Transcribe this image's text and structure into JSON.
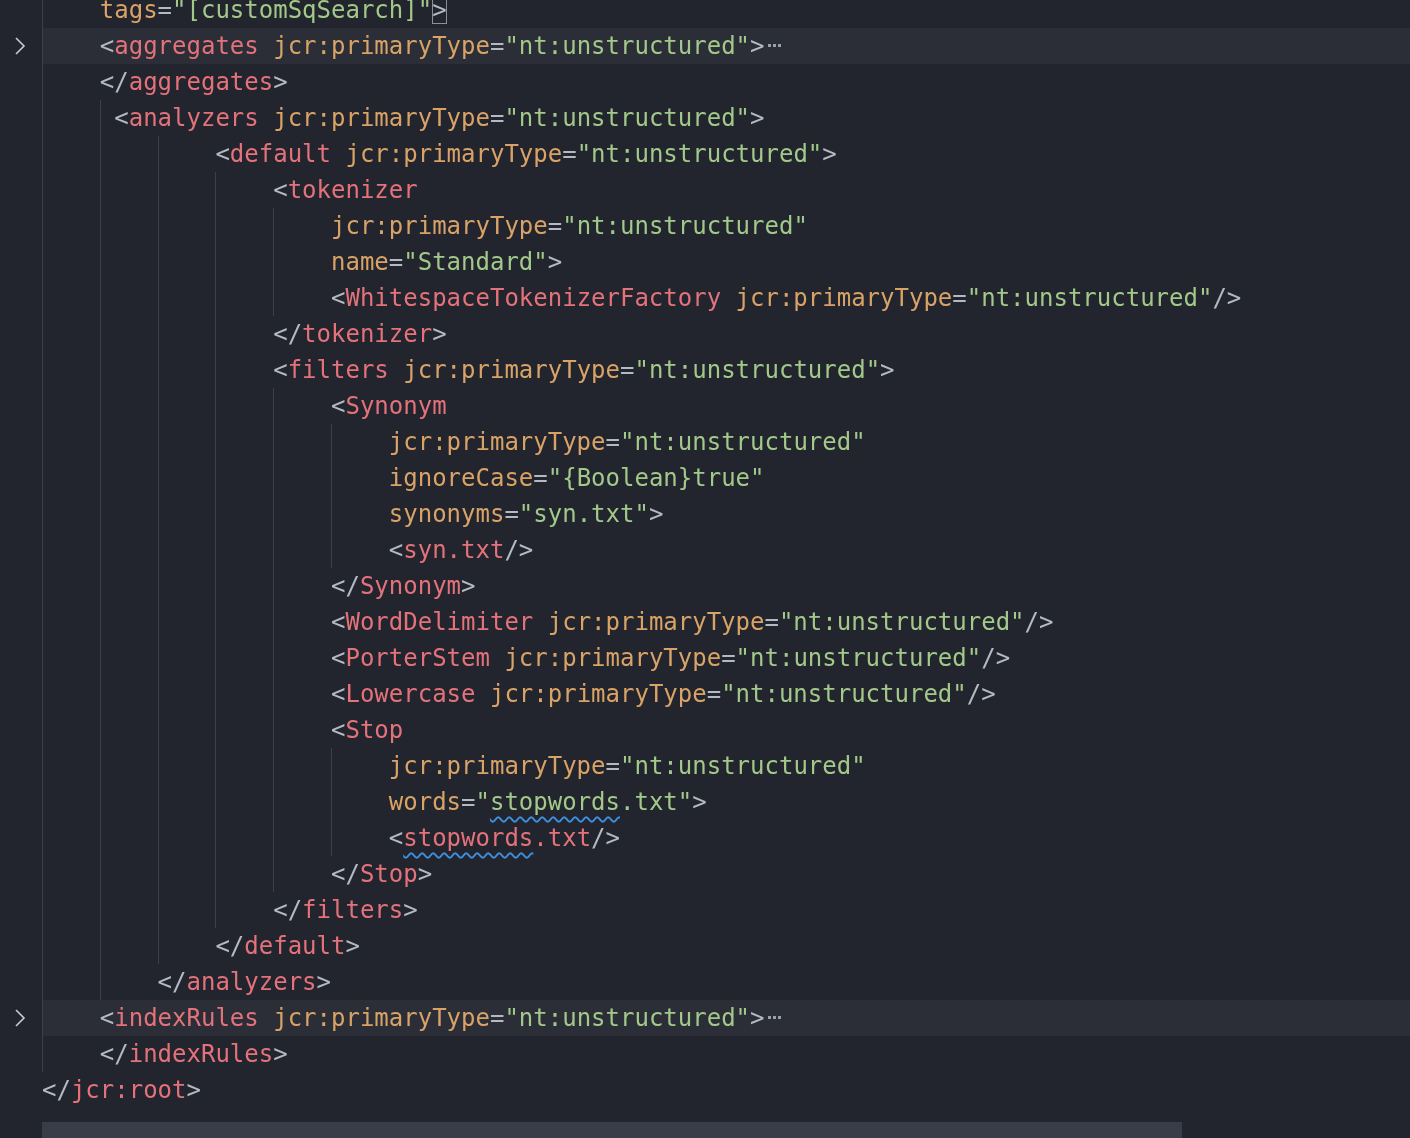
{
  "editor": {
    "lines": [
      {
        "folded": false,
        "tokens": [
          {
            "kind": "attr",
            "text": "    tags"
          },
          {
            "kind": "punct",
            "text": "="
          },
          {
            "kind": "string",
            "text": "\"[customSqSearch]\""
          },
          {
            "kind": "punct",
            "text": ">",
            "cursor": true
          }
        ]
      },
      {
        "folded": true,
        "tokens": [
          {
            "kind": "punct",
            "text": "    <"
          },
          {
            "kind": "tag",
            "text": "aggregates"
          },
          {
            "kind": "attr",
            "text": " jcr:primaryType"
          },
          {
            "kind": "punct",
            "text": "="
          },
          {
            "kind": "string",
            "text": "\"nt:unstructured\""
          },
          {
            "kind": "punct",
            "text": ">"
          }
        ]
      },
      {
        "folded": false,
        "tokens": [
          {
            "kind": "punct",
            "text": "    </"
          },
          {
            "kind": "tag",
            "text": "aggregates"
          },
          {
            "kind": "punct",
            "text": ">"
          }
        ]
      },
      {
        "folded": false,
        "tokens": [
          {
            "kind": "punct",
            "text": "     <"
          },
          {
            "kind": "tag",
            "text": "analyzers"
          },
          {
            "kind": "attr",
            "text": " jcr:primaryType"
          },
          {
            "kind": "punct",
            "text": "="
          },
          {
            "kind": "string",
            "text": "\"nt:unstructured\""
          },
          {
            "kind": "punct",
            "text": ">"
          }
        ]
      },
      {
        "folded": false,
        "tokens": [
          {
            "kind": "punct",
            "text": "            <"
          },
          {
            "kind": "tag",
            "text": "default"
          },
          {
            "kind": "attr",
            "text": " jcr:primaryType"
          },
          {
            "kind": "punct",
            "text": "="
          },
          {
            "kind": "string",
            "text": "\"nt:unstructured\""
          },
          {
            "kind": "punct",
            "text": ">"
          }
        ]
      },
      {
        "folded": false,
        "tokens": [
          {
            "kind": "punct",
            "text": "                <"
          },
          {
            "kind": "tag",
            "text": "tokenizer"
          }
        ]
      },
      {
        "folded": false,
        "tokens": [
          {
            "kind": "attr",
            "text": "                    jcr:primaryType"
          },
          {
            "kind": "punct",
            "text": "="
          },
          {
            "kind": "string",
            "text": "\"nt:unstructured\""
          }
        ]
      },
      {
        "folded": false,
        "tokens": [
          {
            "kind": "attr",
            "text": "                    name"
          },
          {
            "kind": "punct",
            "text": "="
          },
          {
            "kind": "string",
            "text": "\"Standard\""
          },
          {
            "kind": "punct",
            "text": ">"
          }
        ]
      },
      {
        "folded": false,
        "tokens": [
          {
            "kind": "punct",
            "text": "                    <"
          },
          {
            "kind": "tag",
            "text": "WhitespaceTokenizerFactory"
          },
          {
            "kind": "attr",
            "text": " jcr:primaryType"
          },
          {
            "kind": "punct",
            "text": "="
          },
          {
            "kind": "string",
            "text": "\"nt:unstructured\""
          },
          {
            "kind": "punct",
            "text": "/>"
          }
        ]
      },
      {
        "folded": false,
        "tokens": [
          {
            "kind": "punct",
            "text": "                </"
          },
          {
            "kind": "tag",
            "text": "tokenizer"
          },
          {
            "kind": "punct",
            "text": ">"
          }
        ]
      },
      {
        "folded": false,
        "tokens": [
          {
            "kind": "punct",
            "text": "                <"
          },
          {
            "kind": "tag",
            "text": "filters"
          },
          {
            "kind": "attr",
            "text": " jcr:primaryType"
          },
          {
            "kind": "punct",
            "text": "="
          },
          {
            "kind": "string",
            "text": "\"nt:unstructured\""
          },
          {
            "kind": "punct",
            "text": ">"
          }
        ]
      },
      {
        "folded": false,
        "tokens": [
          {
            "kind": "punct",
            "text": "                    <"
          },
          {
            "kind": "tag",
            "text": "Synonym"
          }
        ]
      },
      {
        "folded": false,
        "tokens": [
          {
            "kind": "attr",
            "text": "                        jcr:primaryType"
          },
          {
            "kind": "punct",
            "text": "="
          },
          {
            "kind": "string",
            "text": "\"nt:unstructured\""
          }
        ]
      },
      {
        "folded": false,
        "tokens": [
          {
            "kind": "attr",
            "text": "                        ignoreCase"
          },
          {
            "kind": "punct",
            "text": "="
          },
          {
            "kind": "string",
            "text": "\"{Boolean}true\""
          }
        ]
      },
      {
        "folded": false,
        "tokens": [
          {
            "kind": "attr",
            "text": "                        synonyms"
          },
          {
            "kind": "punct",
            "text": "="
          },
          {
            "kind": "string",
            "text": "\"syn.txt\""
          },
          {
            "kind": "punct",
            "text": ">"
          }
        ]
      },
      {
        "folded": false,
        "tokens": [
          {
            "kind": "punct",
            "text": "                        <"
          },
          {
            "kind": "tag",
            "text": "syn.txt"
          },
          {
            "kind": "punct",
            "text": "/>"
          }
        ]
      },
      {
        "folded": false,
        "tokens": [
          {
            "kind": "punct",
            "text": "                    </"
          },
          {
            "kind": "tag",
            "text": "Synonym"
          },
          {
            "kind": "punct",
            "text": ">"
          }
        ]
      },
      {
        "folded": false,
        "tokens": [
          {
            "kind": "punct",
            "text": "                    <"
          },
          {
            "kind": "tag",
            "text": "WordDelimiter"
          },
          {
            "kind": "attr",
            "text": " jcr:primaryType"
          },
          {
            "kind": "punct",
            "text": "="
          },
          {
            "kind": "string",
            "text": "\"nt:unstructured\""
          },
          {
            "kind": "punct",
            "text": "/>"
          }
        ]
      },
      {
        "folded": false,
        "tokens": [
          {
            "kind": "punct",
            "text": "                    <"
          },
          {
            "kind": "tag",
            "text": "PorterStem"
          },
          {
            "kind": "attr",
            "text": " jcr:primaryType"
          },
          {
            "kind": "punct",
            "text": "="
          },
          {
            "kind": "string",
            "text": "\"nt:unstructured\""
          },
          {
            "kind": "punct",
            "text": "/>"
          }
        ]
      },
      {
        "folded": false,
        "tokens": [
          {
            "kind": "punct",
            "text": "                    <"
          },
          {
            "kind": "tag",
            "text": "Lowercase"
          },
          {
            "kind": "attr",
            "text": " jcr:primaryType"
          },
          {
            "kind": "punct",
            "text": "="
          },
          {
            "kind": "string",
            "text": "\"nt:unstructured\""
          },
          {
            "kind": "punct",
            "text": "/>"
          }
        ]
      },
      {
        "folded": false,
        "tokens": [
          {
            "kind": "punct",
            "text": "                    <"
          },
          {
            "kind": "tag",
            "text": "Stop"
          }
        ]
      },
      {
        "folded": false,
        "tokens": [
          {
            "kind": "attr",
            "text": "                        jcr:primaryType"
          },
          {
            "kind": "punct",
            "text": "="
          },
          {
            "kind": "string",
            "text": "\"nt:unstructured\""
          }
        ]
      },
      {
        "folded": false,
        "tokens": [
          {
            "kind": "attr",
            "text": "                        words"
          },
          {
            "kind": "punct",
            "text": "="
          },
          {
            "kind": "string",
            "text": "\""
          },
          {
            "kind": "string",
            "text": "stopwords",
            "misspelled": true
          },
          {
            "kind": "string",
            "text": ".txt\""
          },
          {
            "kind": "punct",
            "text": ">"
          }
        ]
      },
      {
        "folded": false,
        "tokens": [
          {
            "kind": "punct",
            "text": "                        <"
          },
          {
            "kind": "tag",
            "text": "stopwords",
            "misspelled": true
          },
          {
            "kind": "tag",
            "text": ".txt"
          },
          {
            "kind": "punct",
            "text": "/>"
          }
        ]
      },
      {
        "folded": false,
        "tokens": [
          {
            "kind": "punct",
            "text": "                    </"
          },
          {
            "kind": "tag",
            "text": "Stop"
          },
          {
            "kind": "punct",
            "text": ">"
          }
        ]
      },
      {
        "folded": false,
        "tokens": [
          {
            "kind": "punct",
            "text": "                </"
          },
          {
            "kind": "tag",
            "text": "filters"
          },
          {
            "kind": "punct",
            "text": ">"
          }
        ]
      },
      {
        "folded": false,
        "tokens": [
          {
            "kind": "punct",
            "text": "            </"
          },
          {
            "kind": "tag",
            "text": "default"
          },
          {
            "kind": "punct",
            "text": ">"
          }
        ]
      },
      {
        "folded": false,
        "tokens": [
          {
            "kind": "punct",
            "text": "        </"
          },
          {
            "kind": "tag",
            "text": "analyzers"
          },
          {
            "kind": "punct",
            "text": ">"
          }
        ]
      },
      {
        "folded": true,
        "tokens": [
          {
            "kind": "punct",
            "text": "    <"
          },
          {
            "kind": "tag",
            "text": "indexRules"
          },
          {
            "kind": "attr",
            "text": " jcr:primaryType"
          },
          {
            "kind": "punct",
            "text": "="
          },
          {
            "kind": "string",
            "text": "\"nt:unstructured\""
          },
          {
            "kind": "punct",
            "text": ">"
          }
        ]
      },
      {
        "folded": false,
        "tokens": [
          {
            "kind": "punct",
            "text": "    </"
          },
          {
            "kind": "tag",
            "text": "indexRules"
          },
          {
            "kind": "punct",
            "text": ">"
          }
        ]
      },
      {
        "folded": false,
        "tokens": [
          {
            "kind": "punct",
            "text": "</"
          },
          {
            "kind": "tag",
            "text": "jcr:root"
          },
          {
            "kind": "punct",
            "text": ">"
          }
        ]
      }
    ]
  }
}
